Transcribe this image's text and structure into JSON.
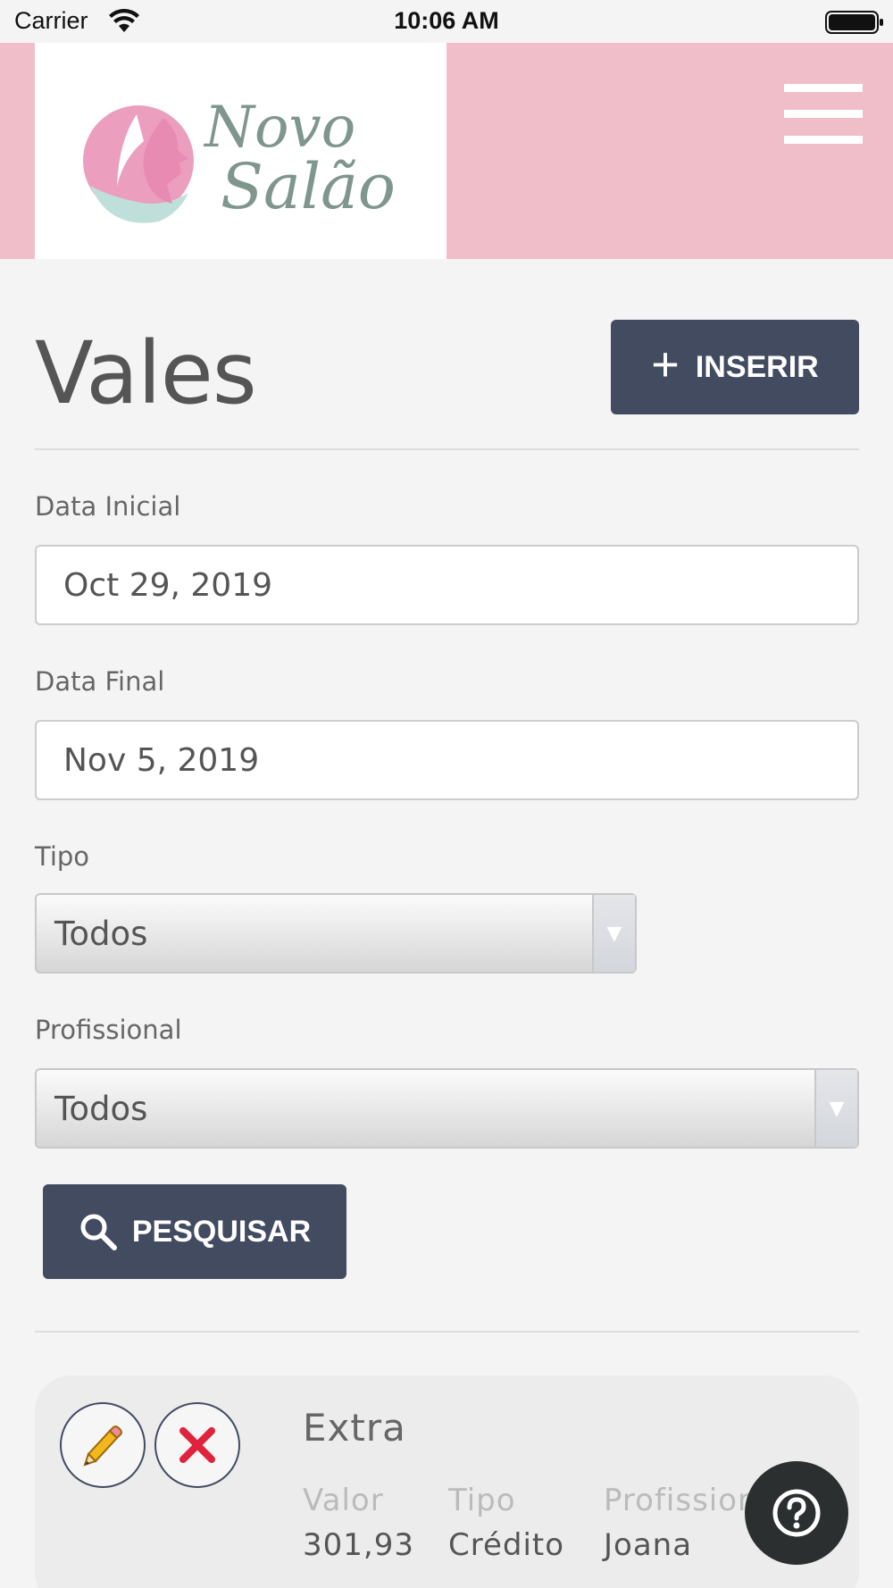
{
  "status_bar": {
    "carrier": "Carrier",
    "time": "10:06 AM"
  },
  "header": {
    "logo_line1": "Novo",
    "logo_line2": "Salão"
  },
  "page": {
    "title": "Vales",
    "insert_label": "INSERIR"
  },
  "filters": {
    "start_date_label": "Data Inicial",
    "start_date_value": "Oct 29, 2019",
    "end_date_label": "Data Final",
    "end_date_value": "Nov 5, 2019",
    "type_label": "Tipo",
    "type_value": "Todos",
    "professional_label": "Profissional",
    "professional_value": "Todos",
    "search_label": "PESQUISAR"
  },
  "results": [
    {
      "title": "Extra",
      "columns": [
        {
          "label": "Valor",
          "value": "301,93"
        },
        {
          "label": "Tipo",
          "value": "Crédito"
        },
        {
          "label": "Profissional",
          "value": "Joana"
        }
      ]
    }
  ],
  "colors": {
    "header_bg": "#f0bec8",
    "button_bg": "#434b61",
    "delete_red": "#e0223c",
    "edit_yellow": "#f2b71b"
  },
  "icons": [
    "wifi-icon",
    "battery-icon",
    "menu-icon",
    "plus-icon",
    "search-icon",
    "pencil-icon",
    "close-icon",
    "help-icon"
  ]
}
